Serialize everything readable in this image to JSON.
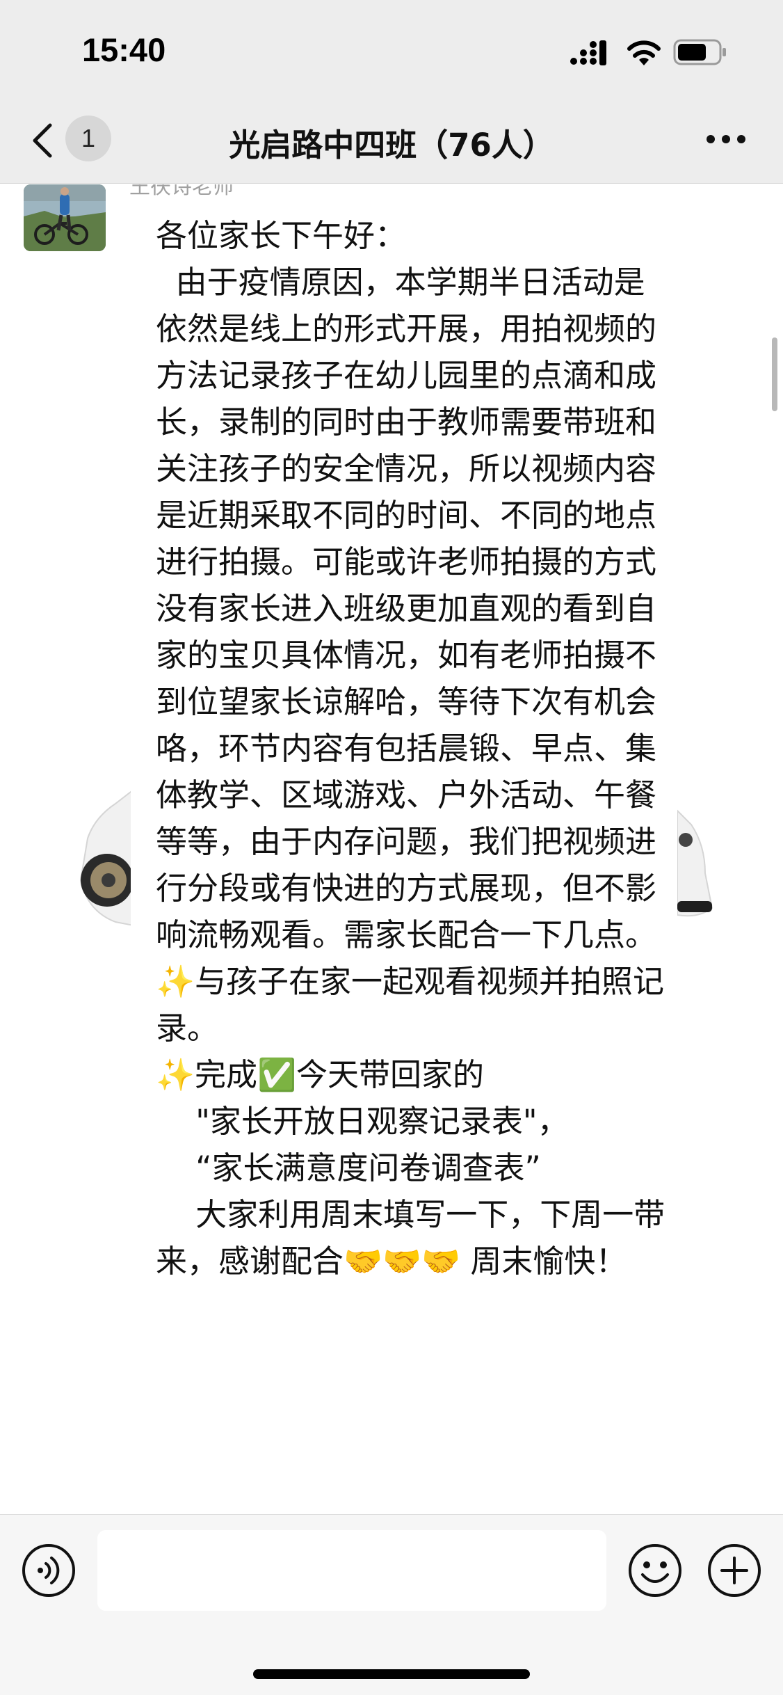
{
  "status_bar": {
    "time": "15:40",
    "icons": [
      "signal-icon",
      "wifi-icon",
      "battery-icon"
    ]
  },
  "nav": {
    "unread_count": "1",
    "title": "光启路中四班（76人）",
    "icons": [
      "back-icon",
      "more-icon"
    ]
  },
  "chat": {
    "sender_name": "王茯诗老师",
    "message": "各位家长下午好：\n  由于疫情原因，本学期半日活动是依然是线上的形式开展，用拍视频的方法记录孩子在幼儿园里的点滴和成长，录制的同时由于教师需要带班和关注孩子的安全情况，所以视频内容是近期采取不同的时间、不同的地点进行拍摄。可能或许老师拍摄的方式没有家长进入班级更加直观的看到自家的宝贝具体情况，如有老师拍摄不到位望家长谅解哈，等待下次有机会咯，环节内容有包括晨锻、早点、集体教学、区域游戏、户外活动、午餐等等，由于内存问题，我们把视频进行分段或有快进的方式展现，但不影响流畅观看。需家长配合一下几点。\n✨与孩子在家一起观看视频并拍照记录。\n✨完成✅今天带回家的\n    \"家长开放日观察记录表\"，\n    “家长满意度问卷调查表”\n    大家利用周末填写一下，下周一带来，感谢配合🤝🤝🤝 周末愉快！"
  },
  "input_bar": {
    "placeholder": "",
    "icons": [
      "voice-icon",
      "emoji-icon",
      "add-icon"
    ]
  }
}
